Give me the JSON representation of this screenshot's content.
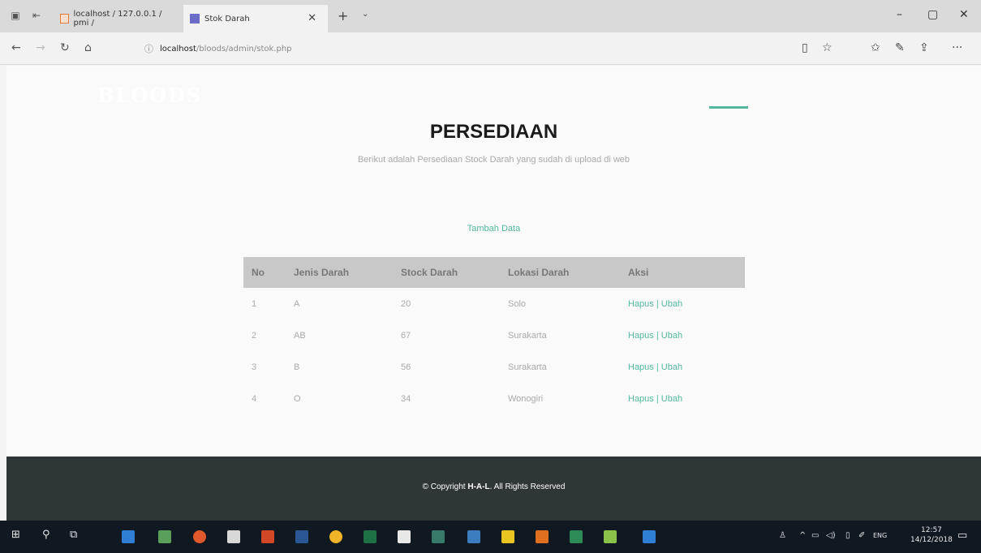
{
  "browser": {
    "tabs": [
      {
        "label": "localhost / 127.0.0.1 / pmi / ",
        "active": false
      },
      {
        "label": "Stok Darah",
        "active": true
      }
    ],
    "address": {
      "host": "localhost",
      "path": "/bloods/admin/stok.php"
    }
  },
  "site": {
    "brand": "BLOODS",
    "heading": "PERSEDIAAN",
    "subheading": "Berikut adalah Persediaan Stock Darah yang sudah di upload di web",
    "add_link": "Tambah Data",
    "table": {
      "headers": [
        "No",
        "Jenis Darah",
        "Stock Darah",
        "Lokasi Darah",
        "Aksi"
      ],
      "rows": [
        {
          "no": "1",
          "jenis": "A",
          "stock": "20",
          "lokasi": "Solo"
        },
        {
          "no": "2",
          "jenis": "AB",
          "stock": "67",
          "lokasi": "Surakarta"
        },
        {
          "no": "3",
          "jenis": "B",
          "stock": "56",
          "lokasi": "Surakarta"
        },
        {
          "no": "4",
          "jenis": "O",
          "stock": "34",
          "lokasi": "Wonogiri"
        }
      ],
      "action_delete": "Hapus",
      "action_separator": "|",
      "action_edit": "Ubah"
    },
    "footer": {
      "prefix": "© Copyright",
      "owner": "H-A-L",
      "suffix": "All Rights Reserved"
    }
  },
  "taskbar": {
    "language": "ENG",
    "time": "12:57",
    "date": "14/12/2018"
  },
  "colors": {
    "accent": "#52b8a0",
    "footer_bg": "#2f3638",
    "table_header_bg": "#c8c8c8"
  }
}
